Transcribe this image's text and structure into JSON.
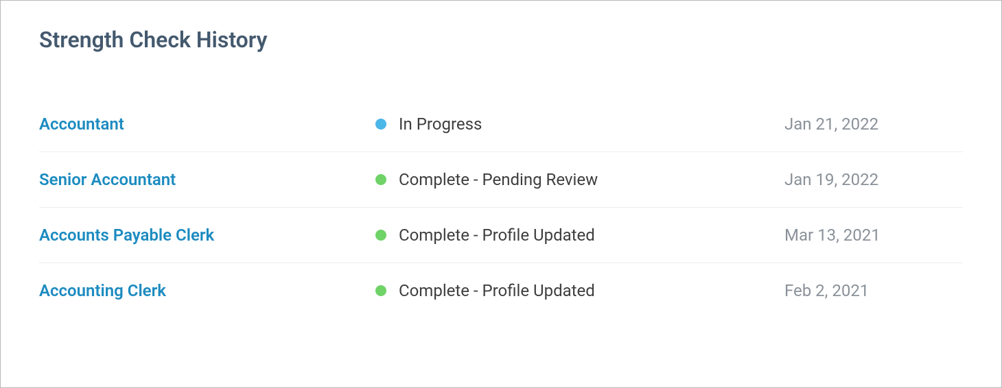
{
  "title": "Strength Check History",
  "status_colors": {
    "in_progress": "#4bb6e8",
    "complete": "#6fd367"
  },
  "rows": [
    {
      "role": "Accountant",
      "status_key": "in_progress",
      "status_text": "In Progress",
      "date": "Jan 21, 2022"
    },
    {
      "role": "Senior Accountant",
      "status_key": "complete",
      "status_text": "Complete - Pending Review",
      "date": "Jan 19, 2022"
    },
    {
      "role": "Accounts Payable Clerk",
      "status_key": "complete",
      "status_text": "Complete - Profile Updated",
      "date": "Mar 13, 2021"
    },
    {
      "role": "Accounting Clerk",
      "status_key": "complete",
      "status_text": "Complete - Profile Updated",
      "date": "Feb 2, 2021"
    }
  ]
}
